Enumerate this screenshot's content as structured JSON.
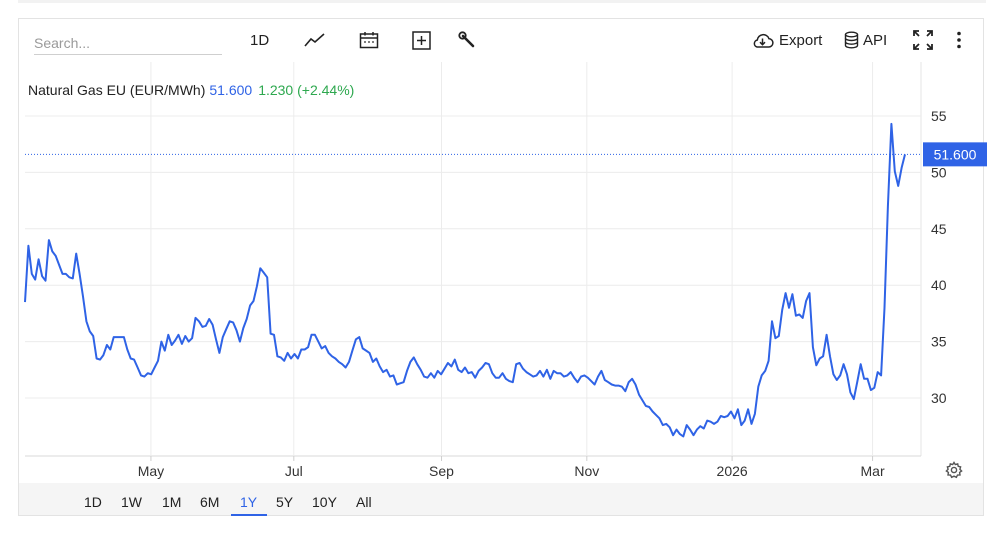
{
  "search": {
    "placeholder": "Search..."
  },
  "toolbar": {
    "interval_label": "1D",
    "export_label": "Export",
    "api_label": "API",
    "icons": [
      "line-chart-icon",
      "calendar-icon",
      "add-indicator-icon",
      "wrench-icon",
      "cloud-download-icon",
      "database-icon",
      "fullscreen-icon",
      "more-vertical-icon"
    ]
  },
  "info": {
    "name": "Natural Gas EU (EUR/MWh)",
    "last": "51.600",
    "change": "1.230 (+2.44%)"
  },
  "range_buttons": [
    "1D",
    "1W",
    "1M",
    "6M",
    "1Y",
    "5Y",
    "10Y",
    "All"
  ],
  "active_range": "1Y",
  "colors": {
    "line": "#2f63e6",
    "positive": "#2ea84f",
    "grid": "#ececec"
  },
  "chart_data": {
    "type": "line",
    "ylim": [
      25,
      56
    ],
    "yticks": [
      30,
      35,
      40,
      45,
      50,
      55
    ],
    "price_label": "51.600",
    "last_value": 51.6,
    "xticks": [
      {
        "label": "May",
        "t": 18
      },
      {
        "label": "Jul",
        "t": 77
      },
      {
        "label": "Sep",
        "t": 138
      },
      {
        "label": "Nov",
        "t": 198
      },
      {
        "label": "2026",
        "t": 258
      },
      {
        "label": "Mar",
        "t": 316
      }
    ],
    "t_range": [
      -34,
      336
    ],
    "series": [
      {
        "values": [
          38.5,
          43.5,
          41,
          40.5,
          42.3,
          40.8,
          40.4,
          44,
          43,
          42.6,
          41.8,
          41,
          41,
          40.7,
          40.6,
          42.8,
          41,
          39,
          36.8,
          35.9,
          35.5,
          33.5,
          33.4,
          33.8,
          34.7,
          34.3,
          35.4,
          35.4,
          35.4,
          35.4,
          34.3,
          33.5,
          33.4,
          32.7,
          32,
          31.9,
          32.2,
          32.1,
          32.7,
          33.3,
          35,
          34.2,
          35.6,
          34.7,
          35.1,
          35.6,
          34.8,
          35.5,
          35,
          35.3,
          37.1,
          36.8,
          36.3,
          36.4,
          37,
          36.5,
          35.2,
          34,
          35.4,
          36.1,
          36.8,
          36.7,
          36,
          35,
          36.2,
          37,
          38.2,
          38.6,
          39.9,
          41.5,
          41.1,
          40.7,
          35.7,
          35.6,
          33.7,
          33.6,
          33.3,
          34,
          33.5,
          33.9,
          33.5,
          34.3,
          34.3,
          34.5,
          35.6,
          35.6,
          35,
          34.4,
          34.6,
          34,
          33.7,
          33.5,
          33.2,
          33,
          32.7,
          33.2,
          34.2,
          35.2,
          35.4,
          34.4,
          34.2,
          34,
          33.2,
          33.5,
          32.8,
          32.3,
          32.5,
          31.9,
          32,
          31.2,
          31.3,
          31.4,
          32.4,
          33.2,
          33.6,
          33,
          32.5,
          31.9,
          31.8,
          32.2,
          31.8,
          32.4,
          32.1,
          32.6,
          33.1,
          32.8,
          33.4,
          32.5,
          32.3,
          32.7,
          32.2,
          32.3,
          31.8,
          32.4,
          32.7,
          33.1,
          33,
          32.2,
          31.8,
          31.8,
          32.2,
          31.7,
          31.5,
          31.4,
          33,
          33.1,
          32.6,
          32.3,
          32.1,
          31.9,
          32,
          32.4,
          31.9,
          32.5,
          31.7,
          32.4,
          32.2,
          32.2,
          31.9,
          32,
          32.3,
          31.8,
          31.4,
          31.9,
          32,
          31.8,
          31.5,
          31.2,
          31.9,
          32.4,
          31.6,
          31.4,
          31.2,
          31.1,
          31.1,
          31,
          30.6,
          31.4,
          31.7,
          31.2,
          30.3,
          29.8,
          29.3,
          29.2,
          28.8,
          28.5,
          28.2,
          27.6,
          27.7,
          27.4,
          26.7,
          27.2,
          26.8,
          26.6,
          27.6,
          27.2,
          26.7,
          27.2,
          27.5,
          27.3,
          28,
          27.9,
          27.7,
          27.9,
          28.4,
          28.3,
          28.4,
          28.8,
          28.2,
          29,
          27.6,
          28,
          29,
          27.7,
          28.6,
          31,
          32,
          32.4,
          33.3,
          36.8,
          35.3,
          35.5,
          37.8,
          39.3,
          38,
          39.2,
          37.3,
          37.4,
          37.1,
          38.6,
          39.3,
          34.5,
          32.9,
          33.5,
          33.7,
          35.6,
          33.7,
          32.1,
          31.6,
          32,
          33,
          32.1,
          30.5,
          29.9,
          31.4,
          33,
          31.7,
          31.7,
          30.7,
          30.9,
          32.3,
          32,
          38,
          47,
          54.3,
          50.1,
          48.8,
          50.4,
          51.6
        ]
      }
    ]
  }
}
